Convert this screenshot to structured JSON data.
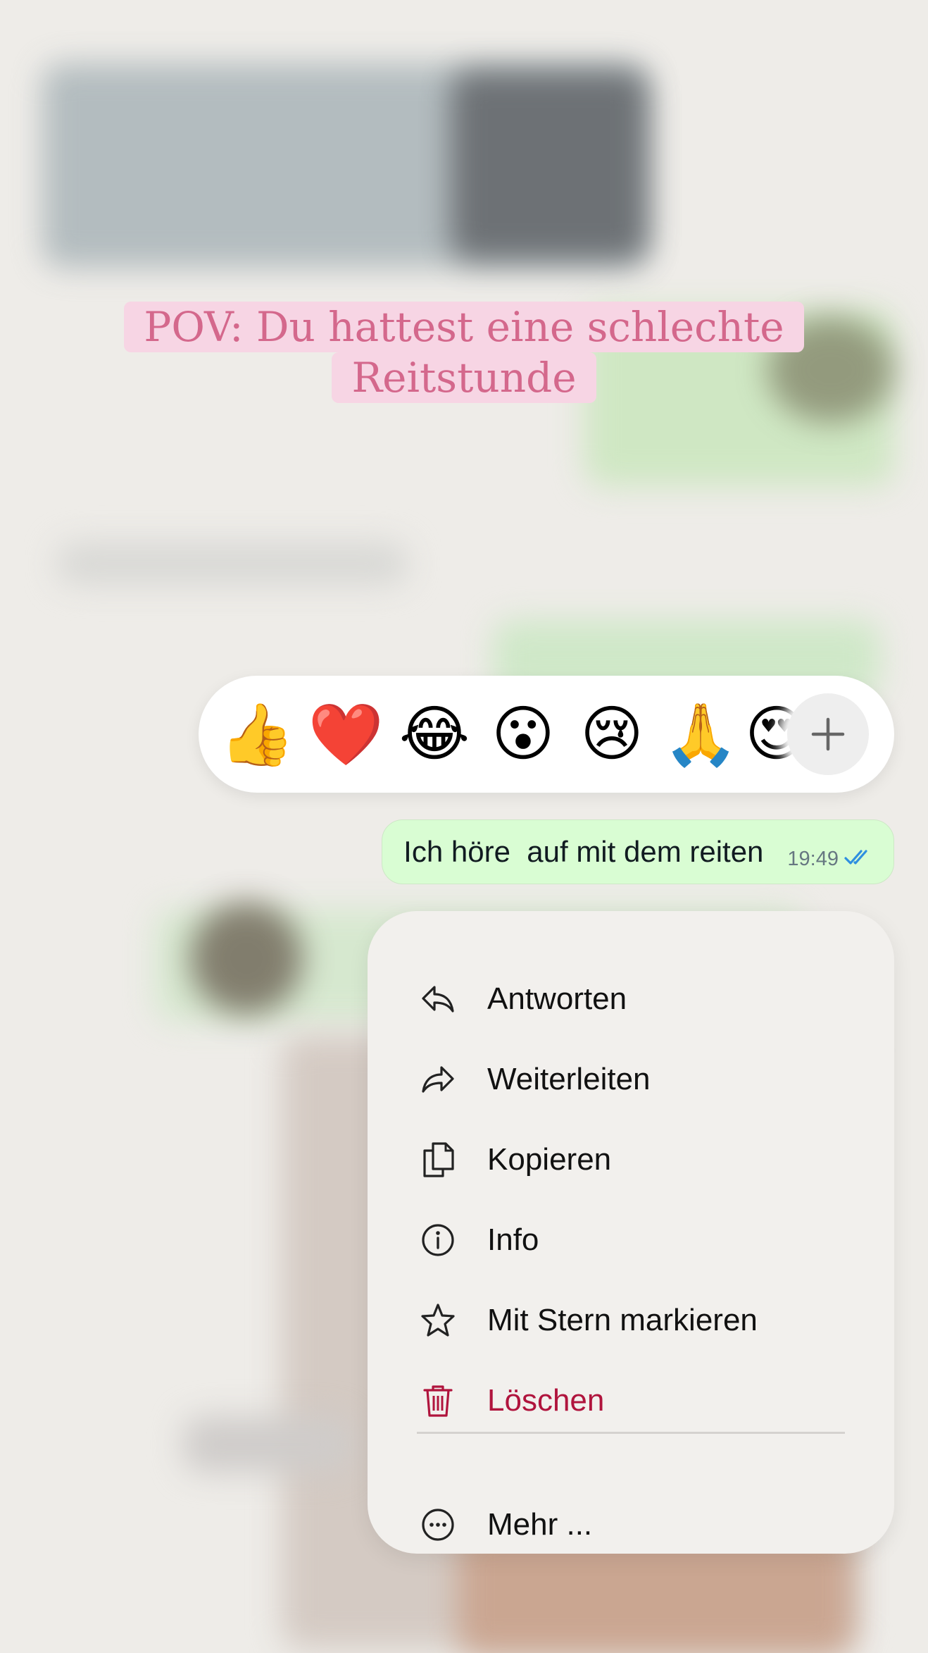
{
  "caption": {
    "line1": "POV: Du hattest eine schlechte",
    "line2": "Reitstunde"
  },
  "reactions": {
    "emojis": [
      "👍",
      "❤️",
      "😂",
      "😮",
      "😢",
      "🙏",
      "😍"
    ],
    "more_label": "+"
  },
  "message": {
    "text": "Ich höre  auf mit dem reiten",
    "time": "19:49",
    "status": "read",
    "tick_color": "#2f8fe0"
  },
  "context_menu": {
    "items": [
      {
        "label": "Antworten",
        "icon": "reply-icon"
      },
      {
        "label": "Weiterleiten",
        "icon": "forward-icon"
      },
      {
        "label": "Kopieren",
        "icon": "copy-icon"
      },
      {
        "label": "Info",
        "icon": "info-icon"
      },
      {
        "label": "Mit Stern markieren",
        "icon": "star-icon"
      },
      {
        "label": "Löschen",
        "icon": "trash-icon",
        "danger": true
      }
    ],
    "more": {
      "label": "Mehr ...",
      "icon": "more-icon"
    },
    "danger_color": "#b0143d"
  }
}
